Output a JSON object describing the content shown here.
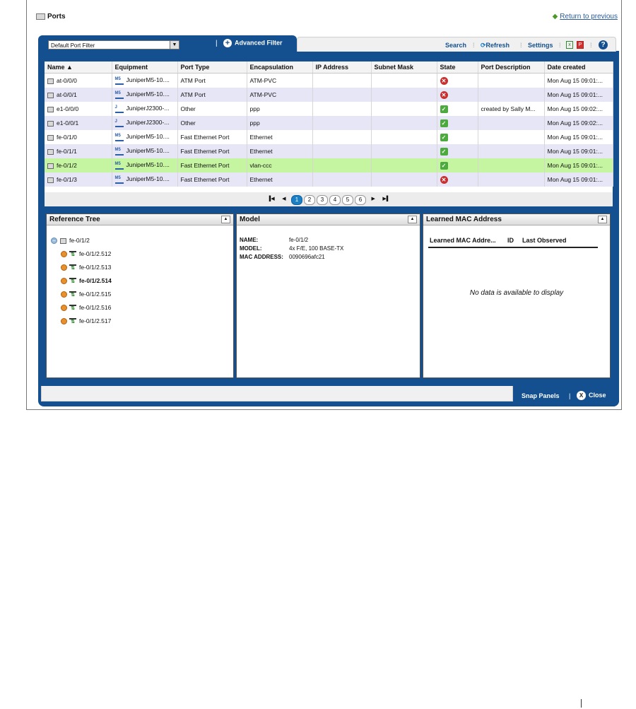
{
  "header": {
    "title": "Ports",
    "return_link": "Return to previous"
  },
  "filter": {
    "selected": "Default Port Filter",
    "advanced_label": "Advanced Filter"
  },
  "toolbar": {
    "search": "Search",
    "refresh": "Refresh",
    "settings": "Settings"
  },
  "table": {
    "columns": [
      "Name ▲",
      "Equipment",
      "Port Type",
      "Encapsulation",
      "IP Address",
      "Subnet Mask",
      "State",
      "Port Description",
      "Date created"
    ],
    "rows": [
      {
        "name": "at-0/0/0",
        "equipment": "JuniperM5-10....",
        "port_type": "ATM Port",
        "encapsulation": "ATM-PVC",
        "ip": "",
        "subnet": "",
        "state": "down",
        "description": "",
        "date": "Mon Aug 15 09:01:..."
      },
      {
        "name": "at-0/0/1",
        "equipment": "JuniperM5-10....",
        "port_type": "ATM Port",
        "encapsulation": "ATM-PVC",
        "ip": "",
        "subnet": "",
        "state": "down",
        "description": "",
        "date": "Mon Aug 15 09:01:..."
      },
      {
        "name": "e1-0/0/0",
        "equipment": "JuniperJ2300-...",
        "port_type": "Other",
        "encapsulation": "ppp",
        "ip": "",
        "subnet": "",
        "state": "up",
        "description": "created by Sally M...",
        "date": "Mon Aug 15 09:02:..."
      },
      {
        "name": "e1-0/0/1",
        "equipment": "JuniperJ2300-...",
        "port_type": "Other",
        "encapsulation": "ppp",
        "ip": "",
        "subnet": "",
        "state": "up",
        "description": "",
        "date": "Mon Aug 15 09:02:..."
      },
      {
        "name": "fe-0/1/0",
        "equipment": "JuniperM5-10....",
        "port_type": "Fast Ethernet Port",
        "encapsulation": "Ethernet",
        "ip": "",
        "subnet": "",
        "state": "up",
        "description": "",
        "date": "Mon Aug 15 09:01:..."
      },
      {
        "name": "fe-0/1/1",
        "equipment": "JuniperM5-10....",
        "port_type": "Fast Ethernet Port",
        "encapsulation": "Ethernet",
        "ip": "",
        "subnet": "",
        "state": "up",
        "description": "",
        "date": "Mon Aug 15 09:01:..."
      },
      {
        "name": "fe-0/1/2",
        "equipment": "JuniperM5-10....",
        "port_type": "Fast Ethernet Port",
        "encapsulation": "vlan-ccc",
        "ip": "",
        "subnet": "",
        "state": "up",
        "description": "",
        "date": "Mon Aug 15 09:01:...",
        "selected": true
      },
      {
        "name": "fe-0/1/3",
        "equipment": "JuniperM5-10....",
        "port_type": "Fast Ethernet Port",
        "encapsulation": "Ethernet",
        "ip": "",
        "subnet": "",
        "state": "down",
        "description": "",
        "date": "Mon Aug 15 09:01:..."
      }
    ]
  },
  "pager": {
    "pages": [
      "1",
      "2",
      "3",
      "4",
      "5",
      "6"
    ],
    "active": "1"
  },
  "reference_tree": {
    "title": "Reference Tree",
    "root": "fe-0/1/2",
    "children": [
      "fe-0/1/2.512",
      "fe-0/1/2.513",
      "fe-0/1/2.514",
      "fe-0/1/2.515",
      "fe-0/1/2.516",
      "fe-0/1/2.517"
    ],
    "bold_child": "fe-0/1/2.514"
  },
  "model": {
    "title": "Model",
    "rows": [
      {
        "key": "NAME:",
        "value": "fe-0/1/2"
      },
      {
        "key": "MODEL:",
        "value": "4x F/E, 100 BASE-TX"
      },
      {
        "key": "MAC ADDRESS:",
        "value": "0090696afc21"
      }
    ]
  },
  "mac": {
    "title": "Learned MAC Address",
    "columns": [
      "Learned MAC Addre...",
      "ID",
      "Last Observed"
    ],
    "empty": "No data is available to display"
  },
  "footer": {
    "snap_panels": "Snap Panels",
    "close": "Close"
  },
  "colors": {
    "panel_blue": "#14508f",
    "row_alt": "#e6e6f6",
    "row_selected": "#c6f5a2",
    "state_up": "#4caa3e",
    "state_down": "#c83030"
  }
}
